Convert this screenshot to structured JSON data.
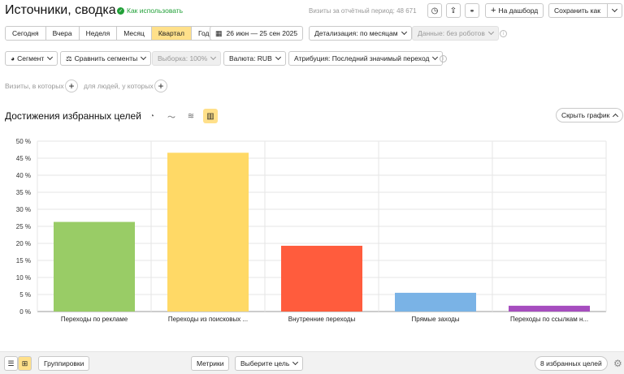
{
  "header": {
    "title": "Источники, сводка",
    "how_to_use": "Как использовать",
    "visits_label": "Визиты за отчётный период: 48 671",
    "add_dashboard": "На дашборд",
    "save_as": "Сохранить как"
  },
  "periods": [
    "Сегодня",
    "Вчера",
    "Неделя",
    "Месяц",
    "Квартал",
    "Год"
  ],
  "active_period": "Квартал",
  "date_range": "26 июн — 25 сен 2025",
  "detail": "Детализация: по месяцам",
  "data_filter": "Данные: без роботов",
  "filters": {
    "segment": "Сегмент",
    "compare": "Сравнить сегменты",
    "sample": "Выборка: 100%",
    "currency": "Валюта: RUB",
    "attribution": "Атрибуция: Последний значимый переход"
  },
  "visits_row": {
    "which": "Визиты, в которых",
    "people": "для людей, у которых"
  },
  "chart_section": {
    "title": "Достижения избранных целей",
    "hide_chart": "Скрыть график"
  },
  "chart_data": {
    "type": "bar",
    "categories": [
      "Переходы по рекламе",
      "Переходы из поисковых ...",
      "Внутренние переходы",
      "Прямые заходы",
      "Переходы по ссылкам н..."
    ],
    "values": [
      26.3,
      46.6,
      19.3,
      5.5,
      1.7
    ],
    "colors": [
      "#99cc66",
      "#ffd966",
      "#ff5c3d",
      "#7ab3e6",
      "#a64dbf"
    ],
    "yticks": [
      "0 %",
      "5 %",
      "10 %",
      "15 %",
      "20 %",
      "25 %",
      "30 %",
      "35 %",
      "40 %",
      "45 %",
      "50 %"
    ],
    "ylim": [
      0,
      50
    ],
    "grid": true
  },
  "bottom": {
    "groupings": "Группировки",
    "metrics": "Метрики",
    "choose_goal": "Выберите цель",
    "fav_goals": "8 избранных целей"
  },
  "colors": {
    "accent": "#ffe08a",
    "ok_green": "#21a038"
  }
}
